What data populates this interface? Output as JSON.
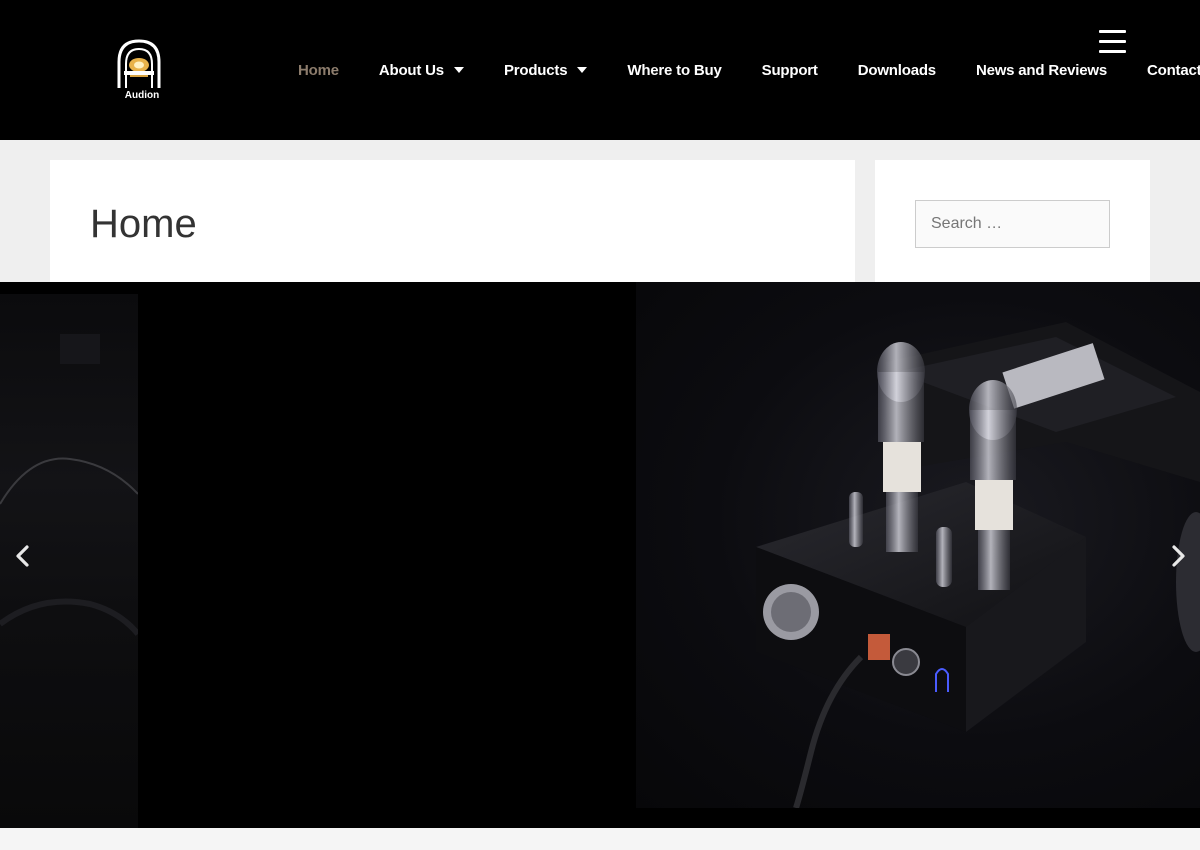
{
  "header": {
    "logo_text": "Audion",
    "nav": [
      {
        "label": "Home",
        "active": true,
        "dropdown": false
      },
      {
        "label": "About Us",
        "active": false,
        "dropdown": true
      },
      {
        "label": "Products",
        "active": false,
        "dropdown": true
      },
      {
        "label": "Where to Buy",
        "active": false,
        "dropdown": false
      },
      {
        "label": "Support",
        "active": false,
        "dropdown": false
      },
      {
        "label": "Downloads",
        "active": false,
        "dropdown": false
      },
      {
        "label": "News and Reviews",
        "active": false,
        "dropdown": false
      },
      {
        "label": "Contact",
        "active": false,
        "dropdown": false
      }
    ],
    "menu_icon": "hamburger-menu-icon"
  },
  "main": {
    "page_title": "Home"
  },
  "sidebar": {
    "search_placeholder": "Search …"
  },
  "slider": {
    "prev_icon": "chevron-left-icon",
    "next_icon": "chevron-right-icon"
  },
  "colors": {
    "header_bg": "#000000",
    "active_nav": "#8c7c6c",
    "page_bg": "#efefef"
  }
}
